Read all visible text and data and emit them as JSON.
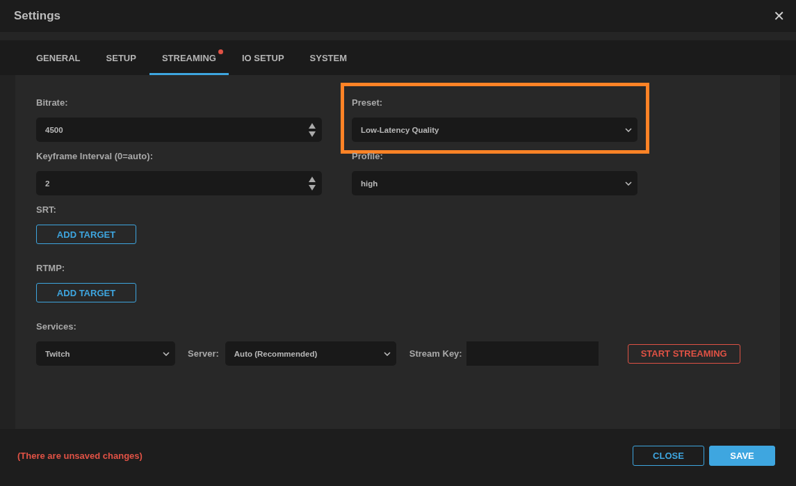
{
  "window": {
    "title": "Settings",
    "close_glyph": "✕"
  },
  "tabs": [
    {
      "label": "GENERAL",
      "selected": false,
      "badge": false
    },
    {
      "label": "SETUP",
      "selected": false,
      "badge": false
    },
    {
      "label": "STREAMING",
      "selected": true,
      "badge": true
    },
    {
      "label": "IO SETUP",
      "selected": false,
      "badge": false
    },
    {
      "label": "SYSTEM",
      "selected": false,
      "badge": false
    }
  ],
  "fields": [
    {
      "label": "Bitrate:",
      "kind": "number",
      "value": "4500",
      "highlighted": false
    },
    {
      "label": "Preset:",
      "kind": "select",
      "value": "Low-Latency Quality",
      "highlighted": true
    },
    {
      "label": "Keyframe Interval (0=auto):",
      "kind": "number",
      "value": "2",
      "highlighted": false
    },
    {
      "label": "Profile:",
      "kind": "select",
      "value": "high",
      "highlighted": false
    }
  ],
  "targets": [
    {
      "label": "SRT:",
      "button": "ADD TARGET"
    },
    {
      "label": "RTMP:",
      "button": "ADD TARGET"
    }
  ],
  "services": {
    "label": "Services:",
    "items": [
      {
        "kind": "select",
        "value": "Twitch"
      },
      {
        "kind": "label",
        "text": "Server:"
      },
      {
        "kind": "select",
        "value": "Auto (Recommended)"
      },
      {
        "kind": "label",
        "text": "Stream Key:"
      },
      {
        "kind": "text",
        "value": ""
      },
      {
        "kind": "button",
        "text": "START STREAMING"
      }
    ]
  },
  "footer": {
    "message": "(There are unsaved changes)",
    "buttons": [
      {
        "label": "CLOSE",
        "kind": "secondary"
      },
      {
        "label": "SAVE",
        "kind": "primary"
      }
    ]
  }
}
